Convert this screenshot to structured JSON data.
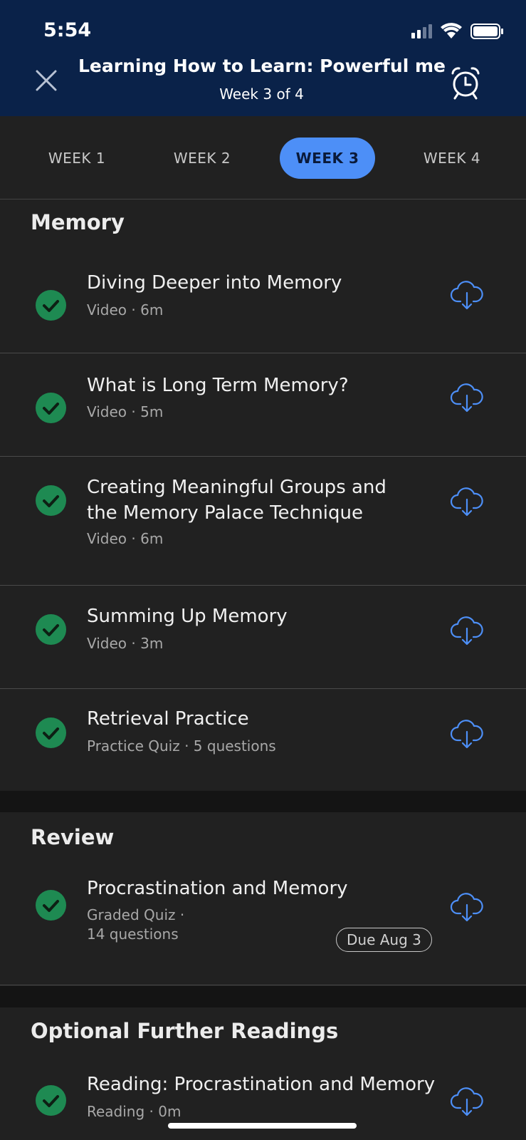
{
  "status_bar": {
    "time": "5:54"
  },
  "header": {
    "title": "Learning How to Learn: Powerful me...",
    "subtitle": "Week 3 of 4"
  },
  "tabs": [
    {
      "label": "WEEK 1",
      "active": false
    },
    {
      "label": "WEEK 2",
      "active": false
    },
    {
      "label": "WEEK 3",
      "active": true
    },
    {
      "label": "WEEK 4",
      "active": false
    }
  ],
  "sections": [
    {
      "title": "Memory",
      "items": [
        {
          "title": "Diving Deeper into Memory",
          "meta": "Video · 6m",
          "completed": true
        },
        {
          "title": "What is Long Term Memory?",
          "meta": "Video · 5m",
          "completed": true
        },
        {
          "title": "Creating Meaningful Groups and the Memory Palace Technique",
          "meta": "Video · 6m",
          "completed": true
        },
        {
          "title": "Summing Up Memory",
          "meta": "Video · 3m",
          "completed": true
        },
        {
          "title": "Retrieval Practice",
          "meta": "Practice Quiz · 5 questions",
          "completed": true
        }
      ]
    },
    {
      "title": "Review",
      "items": [
        {
          "title": "Procrastination and Memory",
          "meta_line1": "Graded Quiz ·",
          "meta_line2": "14 questions",
          "due": "Due Aug 3",
          "completed": true
        }
      ]
    },
    {
      "title": "Optional Further Readings",
      "items": [
        {
          "title": "Reading: Procrastination and Memory",
          "meta": "Reading · 0m",
          "completed": true
        }
      ]
    }
  ],
  "colors": {
    "header_bg": "#0a2249",
    "accent": "#4d8ff7",
    "complete": "#1e8a52",
    "download_icon": "#4d8ff7"
  }
}
